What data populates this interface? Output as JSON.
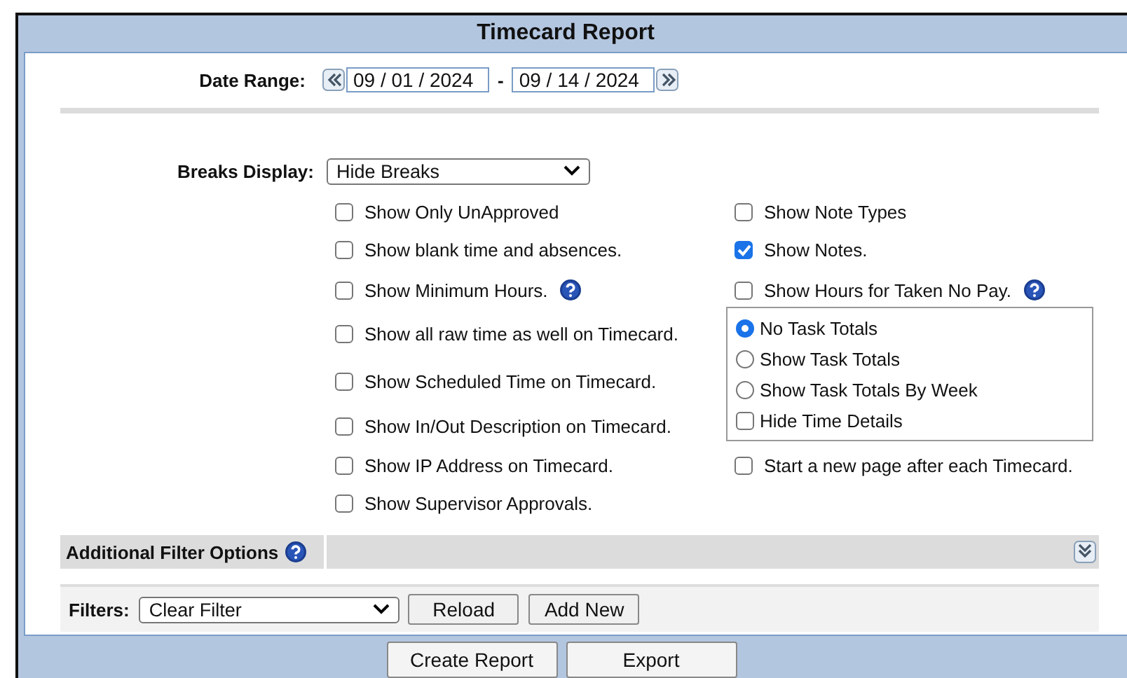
{
  "title": "Timecard Report",
  "date_range": {
    "label": "Date Range:",
    "start": "09 / 01 / 2024",
    "separator": "-",
    "end": "09 / 14 / 2024"
  },
  "breaks_display": {
    "label": "Breaks Display:",
    "value": "Hide Breaks"
  },
  "options_left": [
    {
      "kind": "checkbox",
      "label": "Show Only UnApproved",
      "checked": false
    },
    {
      "kind": "checkbox",
      "label": "Show blank time and absences.",
      "checked": false
    },
    {
      "kind": "checkbox",
      "label": "Show Minimum Hours.",
      "checked": false,
      "help": true
    },
    {
      "kind": "checkbox",
      "label": "Show all raw time as well on Timecard.",
      "checked": false
    },
    {
      "kind": "checkbox",
      "label": "Show Scheduled Time on Timecard.",
      "checked": false
    },
    {
      "kind": "checkbox",
      "label": "Show In/Out Description on Timecard.",
      "checked": false
    },
    {
      "kind": "checkbox",
      "label": "Show IP Address on Timecard.",
      "checked": false
    },
    {
      "kind": "checkbox",
      "label": "Show Supervisor Approvals.",
      "checked": false
    }
  ],
  "options_right": [
    {
      "kind": "checkbox",
      "label": "Show Note Types",
      "checked": false
    },
    {
      "kind": "checkbox",
      "label": "Show Notes.",
      "checked": true
    },
    {
      "kind": "checkbox",
      "label": "Show Hours for Taken No Pay.",
      "checked": false,
      "help": true
    },
    {
      "kind": "group",
      "items": [
        {
          "kind": "radio",
          "label": "No Task Totals",
          "selected": true
        },
        {
          "kind": "radio",
          "label": "Show Task Totals",
          "selected": false
        },
        {
          "kind": "radio",
          "label": "Show Task Totals By Week",
          "selected": false
        },
        {
          "kind": "checkbox",
          "label": "Hide Time Details",
          "checked": false
        }
      ]
    },
    {
      "kind": "checkbox",
      "label": "Start a new page after each Timecard.",
      "checked": false
    }
  ],
  "additional_filter": {
    "label": "Additional Filter Options",
    "expanded": false
  },
  "filters": {
    "label": "Filters:",
    "value": "Clear Filter",
    "buttons": [
      "Reload",
      "Add New"
    ]
  },
  "actions": [
    "Create Report",
    "Export"
  ]
}
